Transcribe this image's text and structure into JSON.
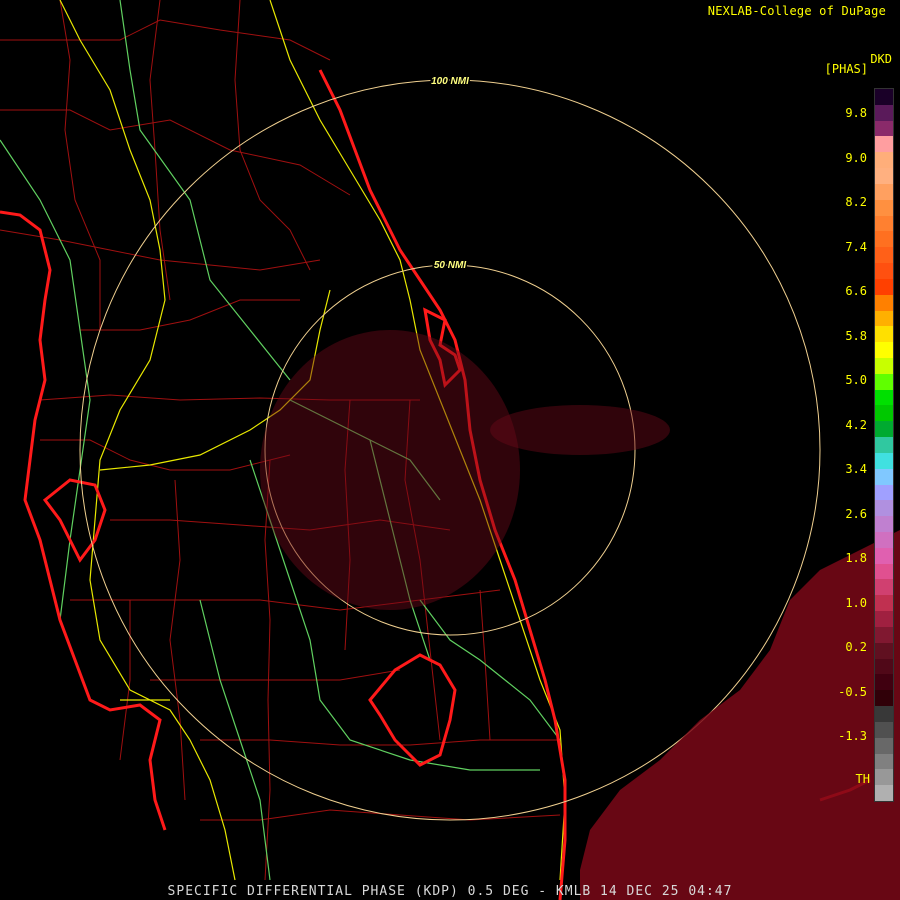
{
  "credit": "NEXLAB-College of DuPage",
  "footer": "SPECIFIC DIFFERENTIAL PHASE (KDP) 0.5 DEG - KMLB 14 DEC 25 04:47",
  "range_rings": [
    {
      "label": "100 NMI"
    },
    {
      "label": "50 NMI"
    }
  ],
  "legend": {
    "title": "DKD",
    "unit": "[PHAS]",
    "ticks": [
      "9.8",
      "9.0",
      "8.2",
      "7.4",
      "6.6",
      "5.8",
      "5.0",
      "4.2",
      "3.4",
      "2.6",
      "1.8",
      "1.0",
      "0.2",
      "-0.5",
      "-1.3",
      "TH"
    ],
    "colors": [
      "#1a0028",
      "#5a1a5a",
      "#8a2a6a",
      "#ff9ea0",
      "#ffae7a",
      "#ffb080",
      "#ffa060",
      "#ff9040",
      "#ff8030",
      "#ff7020",
      "#ff6018",
      "#ff5010",
      "#ff4000",
      "#ff8000",
      "#ffb000",
      "#ffe000",
      "#ffff00",
      "#c8ff00",
      "#60ff00",
      "#00e000",
      "#00c800",
      "#00aa30",
      "#30c8a0",
      "#40e0e0",
      "#80c8ff",
      "#a0a0ff",
      "#b090e0",
      "#c080d0",
      "#d070c0",
      "#e060b0",
      "#e05090",
      "#d04070",
      "#c03050",
      "#a02040",
      "#801830",
      "#601020",
      "#500818",
      "#400010",
      "#300008",
      "#383838",
      "#505050",
      "#686868",
      "#808080",
      "#989898",
      "#b0b0b0"
    ]
  }
}
